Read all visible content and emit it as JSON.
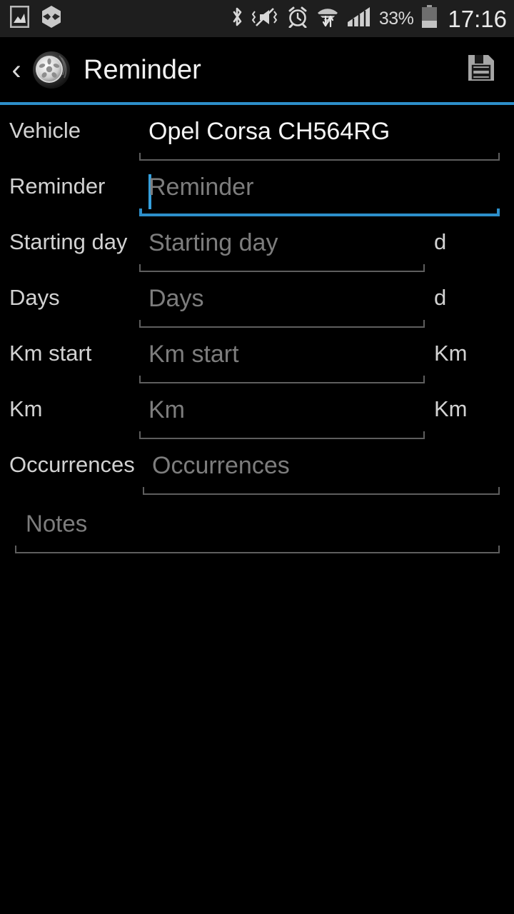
{
  "status_bar": {
    "icons_left": [
      "screenshot-icon",
      "hexagon-app-icon"
    ],
    "icons_right": [
      "bluetooth-icon",
      "sound-mute-vibrate-icon",
      "alarm-clock-icon",
      "wifi-data-transfer-icon",
      "cell-signal-icon"
    ],
    "battery_percent": "33%",
    "battery_level": 33,
    "clock": "17:16"
  },
  "action_bar": {
    "back_label": "‹",
    "app_icon": "tire-wheel-icon",
    "title": "Reminder",
    "save_icon": "floppy-save-icon",
    "accent_color": "#2d8fca"
  },
  "form": {
    "rows": [
      {
        "label": "Vehicle",
        "value": "Opel Corsa CH564RG",
        "placeholder": "",
        "unit": "",
        "filled": true,
        "focused": false,
        "wide": true
      },
      {
        "label": "Reminder",
        "value": "",
        "placeholder": "Reminder",
        "unit": "",
        "filled": false,
        "focused": true,
        "wide": true
      },
      {
        "label": "Starting day",
        "value": "",
        "placeholder": "Starting day",
        "unit": "d",
        "filled": false,
        "focused": false,
        "wide": false
      },
      {
        "label": "Days",
        "value": "",
        "placeholder": "Days",
        "unit": "d",
        "filled": false,
        "focused": false,
        "wide": false
      },
      {
        "label": "Km start",
        "value": "",
        "placeholder": "Km start",
        "unit": "Km",
        "filled": false,
        "focused": false,
        "wide": false
      },
      {
        "label": "Km",
        "value": "",
        "placeholder": "Km",
        "unit": "Km",
        "filled": false,
        "focused": false,
        "wide": false
      },
      {
        "label": "Occurrences",
        "value": "",
        "placeholder": "Occurrences",
        "unit": "",
        "filled": false,
        "focused": false,
        "wide": true
      }
    ],
    "notes": {
      "value": "",
      "placeholder": "Notes"
    }
  },
  "colors": {
    "background": "#000000",
    "status_bar_bg": "#1e1e1e",
    "accent": "#2d8fca",
    "label_text": "#d2d2d2",
    "placeholder_text": "#7d7d7d",
    "value_text": "#f4f4f4",
    "underline": "#5e5e5e"
  }
}
